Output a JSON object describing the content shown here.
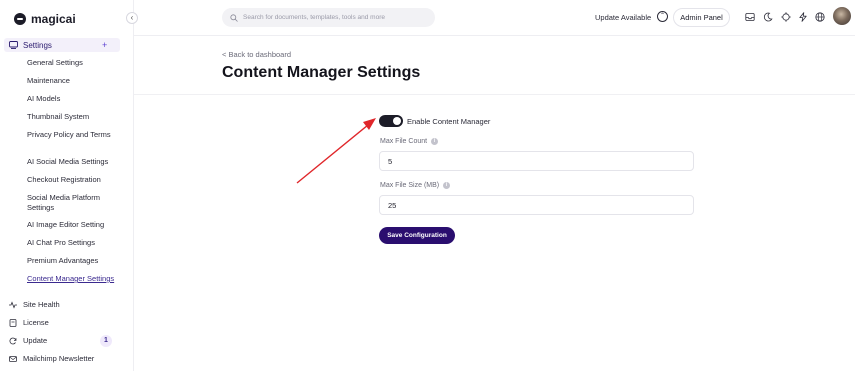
{
  "brand": {
    "name": "magicai"
  },
  "sidebar": {
    "collapse_icon": "chevron-left-icon",
    "settings": {
      "label": "Settings",
      "plus": "+"
    },
    "sub_items": [
      {
        "label": "General Settings"
      },
      {
        "label": "Maintenance"
      },
      {
        "label": "AI Models"
      },
      {
        "label": "Thumbnail System"
      },
      {
        "label": "Privacy Policy and Terms"
      },
      {
        "label": "AI Social Media Settings"
      },
      {
        "label": "Checkout Registration"
      },
      {
        "label": "Social Media Platform Settings"
      },
      {
        "label": "AI Image Editor Setting"
      },
      {
        "label": "AI Chat Pro Settings"
      },
      {
        "label": "Premium Advantages"
      },
      {
        "label": "Content Manager Settings"
      }
    ],
    "main_items": [
      {
        "label": "Site Health",
        "icon": "pulse-icon"
      },
      {
        "label": "License",
        "icon": "license-icon"
      },
      {
        "label": "Update",
        "icon": "refresh-icon",
        "badge": "1"
      },
      {
        "label": "Mailchimp Newsletter",
        "icon": "mail-icon"
      }
    ]
  },
  "topbar": {
    "search_placeholder": "Search for documents, templates, tools and more",
    "update_available": "Update Available",
    "admin_panel": "Admin Panel",
    "icons": [
      "inbox-icon",
      "moon-icon",
      "target-icon",
      "bolt-icon",
      "globe-icon",
      "avatar"
    ]
  },
  "main": {
    "back_link": "< Back to dashboard",
    "title": "Content Manager Settings",
    "toggle_label": "Enable Content Manager",
    "toggle_on": true,
    "max_file_count_label": "Max File Count",
    "max_file_count_value": "5",
    "max_file_size_label": "Max File Size (MB)",
    "max_file_size_value": "25",
    "save_label": "Save Configuration"
  },
  "colors": {
    "accent": "#2a0e6f",
    "arrow": "#e0262a",
    "active_bg": "#f3f0fa"
  }
}
